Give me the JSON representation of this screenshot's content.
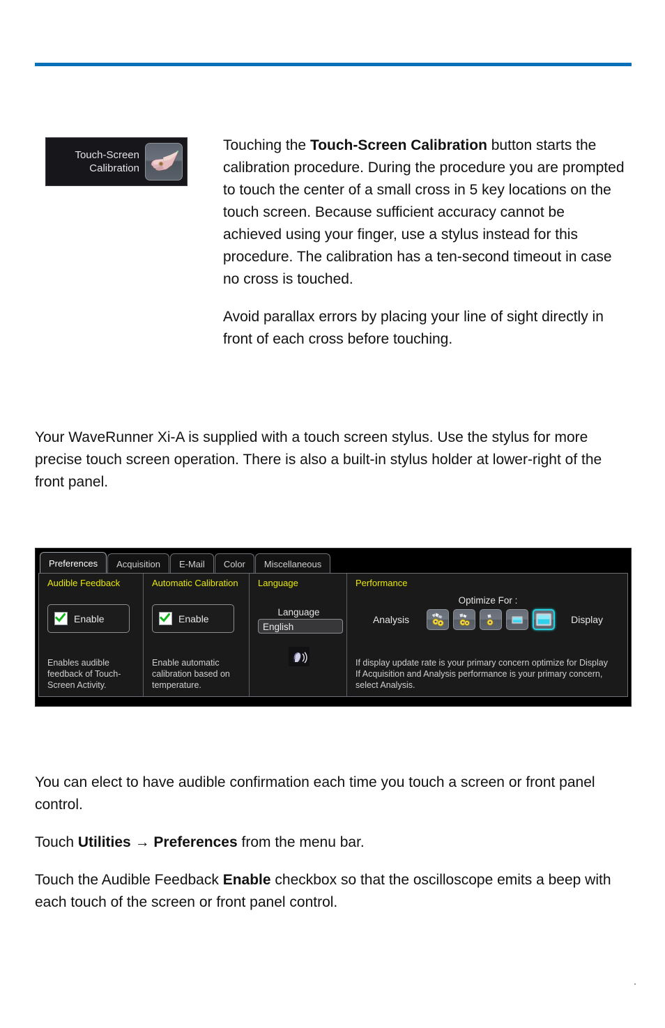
{
  "page": {
    "rule_color": "#0a70b8"
  },
  "calibration_button": {
    "label": "Touch-Screen\nCalibration",
    "icon": "pointing-hand-icon"
  },
  "intro": {
    "para1_a": "Touching the ",
    "para1_bold": "Touch-Screen Calibration",
    "para1_b": " button starts the calibration procedure. During the procedure you are prompted to touch the center of a small cross in 5 key locations on the touch screen. Because sufficient accuracy cannot be achieved using your finger, use a stylus instead for this procedure. The calibration has a ten-second timeout in case no cross is touched.",
    "para2": "Avoid parallax errors by placing your line of sight directly in front of each cross before touching."
  },
  "stylus_para": "Your WaveRunner Xi-A is supplied with a touch screen stylus. Use the stylus for more precise touch screen operation. There is also a built-in stylus holder at lower-right of the front panel.",
  "scope": {
    "tabs": [
      {
        "label": "Preferences",
        "active": true
      },
      {
        "label": "Acquisition",
        "active": false
      },
      {
        "label": "E-Mail",
        "active": false
      },
      {
        "label": "Color",
        "active": false
      },
      {
        "label": "Miscellaneous",
        "active": false
      }
    ],
    "accent_title_color": "#e8e80a",
    "audible_feedback": {
      "title": "Audible Feedback",
      "checkbox_label": "Enable",
      "checked": true,
      "description": "Enables audible\nfeedback of Touch-\nScreen Activity."
    },
    "automatic_calibration": {
      "title": "Automatic Calibration",
      "checkbox_label": "Enable",
      "checked": true,
      "description": "Enable automatic\ncalibration based on\ntemperature."
    },
    "language": {
      "title": "Language",
      "field_label": "Language",
      "value": "English",
      "icon": "speaking-head-icon"
    },
    "performance": {
      "title": "Performance",
      "optimize_label": "Optimize For :",
      "left_label": "Analysis",
      "right_label": "Display",
      "buttons": [
        {
          "name": "optimize-analysis-max",
          "selected": false
        },
        {
          "name": "optimize-analysis-high",
          "selected": false
        },
        {
          "name": "optimize-balanced",
          "selected": false
        },
        {
          "name": "optimize-display-high",
          "selected": false
        },
        {
          "name": "optimize-display-max",
          "selected": true
        }
      ],
      "selected_index": 4,
      "selection_color": "#25d2e0",
      "description": "If display update rate is your primary concern optimize for Display\nIf Acquisition and Analysis performance is your primary concern,\nselect Analysis."
    }
  },
  "bottom": {
    "para1": "You can elect to have audible confirmation each time you touch a screen or front panel control.",
    "para2_a": "Touch ",
    "para2_bold1": "Utilities",
    "para2_arrow": " → ",
    "para2_bold2": "Preferences",
    "para2_b": " from the menu bar.",
    "para3_a": "Touch the Audible Feedback ",
    "para3_bold": "Enable",
    "para3_b": " checkbox so that the oscilloscope emits a beep with each touch of the screen or front panel control."
  }
}
